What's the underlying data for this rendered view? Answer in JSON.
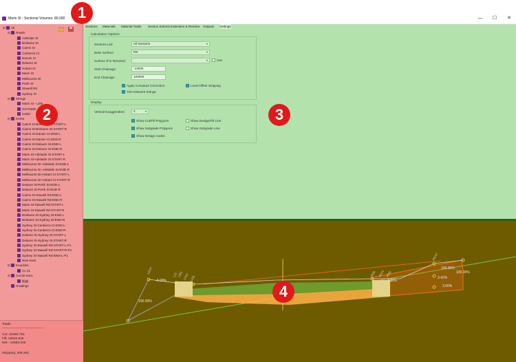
{
  "window": {
    "title": "Marin St - Sectional Volumes: 80.000",
    "minimize": "—",
    "maximize": "☐",
    "close": "✕"
  },
  "callouts": [
    "1",
    "2",
    "3",
    "4"
  ],
  "tree": {
    "rows": [
      {
        "label": "All",
        "level": 0,
        "exp": "⊟"
      },
      {
        "label": "Roads",
        "level": 1,
        "exp": "⊟"
      },
      {
        "label": "Adelaide St",
        "level": 2,
        "exp": ""
      },
      {
        "label": "Brisbane St",
        "level": 2,
        "exp": ""
      },
      {
        "label": "Cairns St",
        "level": 2,
        "exp": ""
      },
      {
        "label": "Canberra Ct",
        "level": 2,
        "exp": ""
      },
      {
        "label": "Darwin Ct",
        "level": 2,
        "exp": ""
      },
      {
        "label": "Delaore St",
        "level": 2,
        "exp": ""
      },
      {
        "label": "Hobart Ct",
        "level": 2,
        "exp": ""
      },
      {
        "label": "Marin St",
        "level": 2,
        "exp": ""
      },
      {
        "label": "Melbourne Dr",
        "level": 2,
        "exp": ""
      },
      {
        "label": "Perth St",
        "level": 2,
        "exp": ""
      },
      {
        "label": "Stawell Rd",
        "level": 2,
        "exp": ""
      },
      {
        "label": "Sydney St",
        "level": 2,
        "exp": ""
      },
      {
        "label": "Strings",
        "level": 1,
        "exp": "⊟"
      },
      {
        "label": "Marin St - LEB",
        "level": 2,
        "exp": ""
      },
      {
        "label": "OUTSIDE",
        "level": 2,
        "exp": ""
      },
      {
        "label": "inside",
        "level": 2,
        "exp": ""
      },
      {
        "label": "Kerbs",
        "level": 1,
        "exp": "⊟"
      },
      {
        "label": "Cairns St-Brisbane St-START-L",
        "level": 2,
        "exp": ""
      },
      {
        "label": "Cairns St-Brisbane St-START-R",
        "level": 2,
        "exp": ""
      },
      {
        "label": "Cairns St-Darwin Ct-END-L",
        "level": 2,
        "exp": ""
      },
      {
        "label": "Cairns St-Darwin Ct-END-R",
        "level": 2,
        "exp": ""
      },
      {
        "label": "Cairns St-Delaore St-END-L",
        "level": 2,
        "exp": ""
      },
      {
        "label": "Cairns St-Delaore St-END-R",
        "level": 2,
        "exp": ""
      },
      {
        "label": "Marin St-Adelaide St-START-L",
        "level": 2,
        "exp": ""
      },
      {
        "label": "Marin St-Adelaide St-START-R",
        "level": 2,
        "exp": ""
      },
      {
        "label": "Melbourne Dr-Adelaide St-END-L",
        "level": 2,
        "exp": ""
      },
      {
        "label": "Melbourne Dr-Adelaide St-END-R",
        "level": 2,
        "exp": ""
      },
      {
        "label": "Melbourne Dr-Hobart Ct-START-L",
        "level": 2,
        "exp": ""
      },
      {
        "label": "Melbourne Dr-Hobart Ct-START-R",
        "level": 2,
        "exp": ""
      },
      {
        "label": "Delaore St-Perth St-END-L",
        "level": 2,
        "exp": ""
      },
      {
        "label": "Delaore St-Perth St-END-R",
        "level": 2,
        "exp": ""
      },
      {
        "label": "Cairns St-Stawell Rd-END-L",
        "level": 2,
        "exp": ""
      },
      {
        "label": "Cairns St-Stawell Rd-END-R",
        "level": 2,
        "exp": ""
      },
      {
        "label": "Marin St-Stawell Rd-START-L",
        "level": 2,
        "exp": ""
      },
      {
        "label": "Marin St-Stawell Rd-START-R",
        "level": 2,
        "exp": ""
      },
      {
        "label": "Brisbane St-Sydney St-END-L",
        "level": 2,
        "exp": ""
      },
      {
        "label": "Brisbane St-Sydney St-END-R",
        "level": 2,
        "exp": ""
      },
      {
        "label": "Sydney St-Canberra Ct-END-L",
        "level": 2,
        "exp": ""
      },
      {
        "label": "Sydney St-Canberra Ct-END-R",
        "level": 2,
        "exp": ""
      },
      {
        "label": "Delaore St-Sydney St-START-L",
        "level": 2,
        "exp": ""
      },
      {
        "label": "Delaore St-Sydney St-START-R",
        "level": 2,
        "exp": ""
      },
      {
        "label": "Sydney St-Stawell Rd-START-L-P1",
        "level": 2,
        "exp": ""
      },
      {
        "label": "Sydney St-Stawell Rd-START-R-P1",
        "level": 2,
        "exp": ""
      },
      {
        "label": "Sydney St-Stawell Rd-END-L-P1",
        "level": 2,
        "exp": ""
      },
      {
        "label": "New Kerb",
        "level": 2,
        "exp": ""
      },
      {
        "label": "Knuckles",
        "level": 1,
        "exp": "⊟"
      },
      {
        "label": "CL 01",
        "level": 2,
        "exp": ""
      },
      {
        "label": "Cul-de-sacs",
        "level": 1,
        "exp": "⊟"
      },
      {
        "label": "fjfjgfj",
        "level": 2,
        "exp": ""
      },
      {
        "label": "Gradings",
        "level": 1,
        "exp": ""
      }
    ]
  },
  "totals": {
    "heading": "Totals",
    "cut": "Cut: 23493.751",
    "fill": "Fill: 10910.526",
    "net": "Net: -12583.225",
    "stripping": "Stripping: 309.202"
  },
  "tabs": [
    {
      "label": "Sections",
      "active": false
    },
    {
      "label": "Materials",
      "active": false
    },
    {
      "label": "Material Totals",
      "active": false
    },
    {
      "label": "Section Extents",
      "active": false
    },
    {
      "label": "Extension & Resolve",
      "active": false
    },
    {
      "label": "Outputs",
      "active": false
    },
    {
      "label": "Settings",
      "active": true
    }
  ],
  "calc_options": {
    "title": "Calculation Options",
    "sections_list_label": "Sections List:",
    "sections_list_value": "All Sections",
    "base_surface_label": "Base Surface:",
    "base_surface_value": "NS",
    "surface_resolve_label": "Surface (For Resolve):",
    "surface_resolve_value": "",
    "use_label": "Use",
    "start_chainage_label": "Start Chainage:",
    "start_chainage_value": "-10000",
    "end_chainage_label": "End Chainage:",
    "end_chainage_value": "100000",
    "apply_curvature": "Apply Curvature Correction",
    "level_offset": "Level Offset Stripping",
    "trim_network": "Trim Network Strings"
  },
  "display": {
    "title": "Display",
    "vert_exag_label": "Vertical Exaggeration:",
    "vert_exag_value": "2",
    "show_cut_fill": "Show Cut/Fill Polygons",
    "show_design_fill_line": "Show Design/Fill Line",
    "show_subgrade_polygons": "Show Subgrade Polygons",
    "show_subgrade_line": "Show Subgrade Line",
    "show_design_codes": "Show Design Codes"
  },
  "section_view": {
    "labels": {
      "left_grade": "100.00%",
      "right_grade_1": "100.00%",
      "right_grade_2": "100.00%",
      "pct_neg_left": "-3.00%",
      "pct_neg_right": "-3.00%",
      "pct_mid_right": "3.42%",
      "pct_low_right": "3.00%",
      "code_lext": "LEXT",
      "code_lis": "LIS",
      "code_lbs": "LBS",
      "code_linv": "LINV",
      "code_leb": "LEB",
      "code_reb": "REB",
      "code_rinv": "RINV",
      "code_rbs": "RBS",
      "code_rext": "REXT"
    },
    "colors": {
      "background": "#6e5b00",
      "cut": "#ff6a1a",
      "fill": "#ffb347",
      "subgrade": "#6f9a2c",
      "natural": "#7bc44a",
      "kerb": "#e3d48a",
      "point": "#f0e040"
    }
  }
}
